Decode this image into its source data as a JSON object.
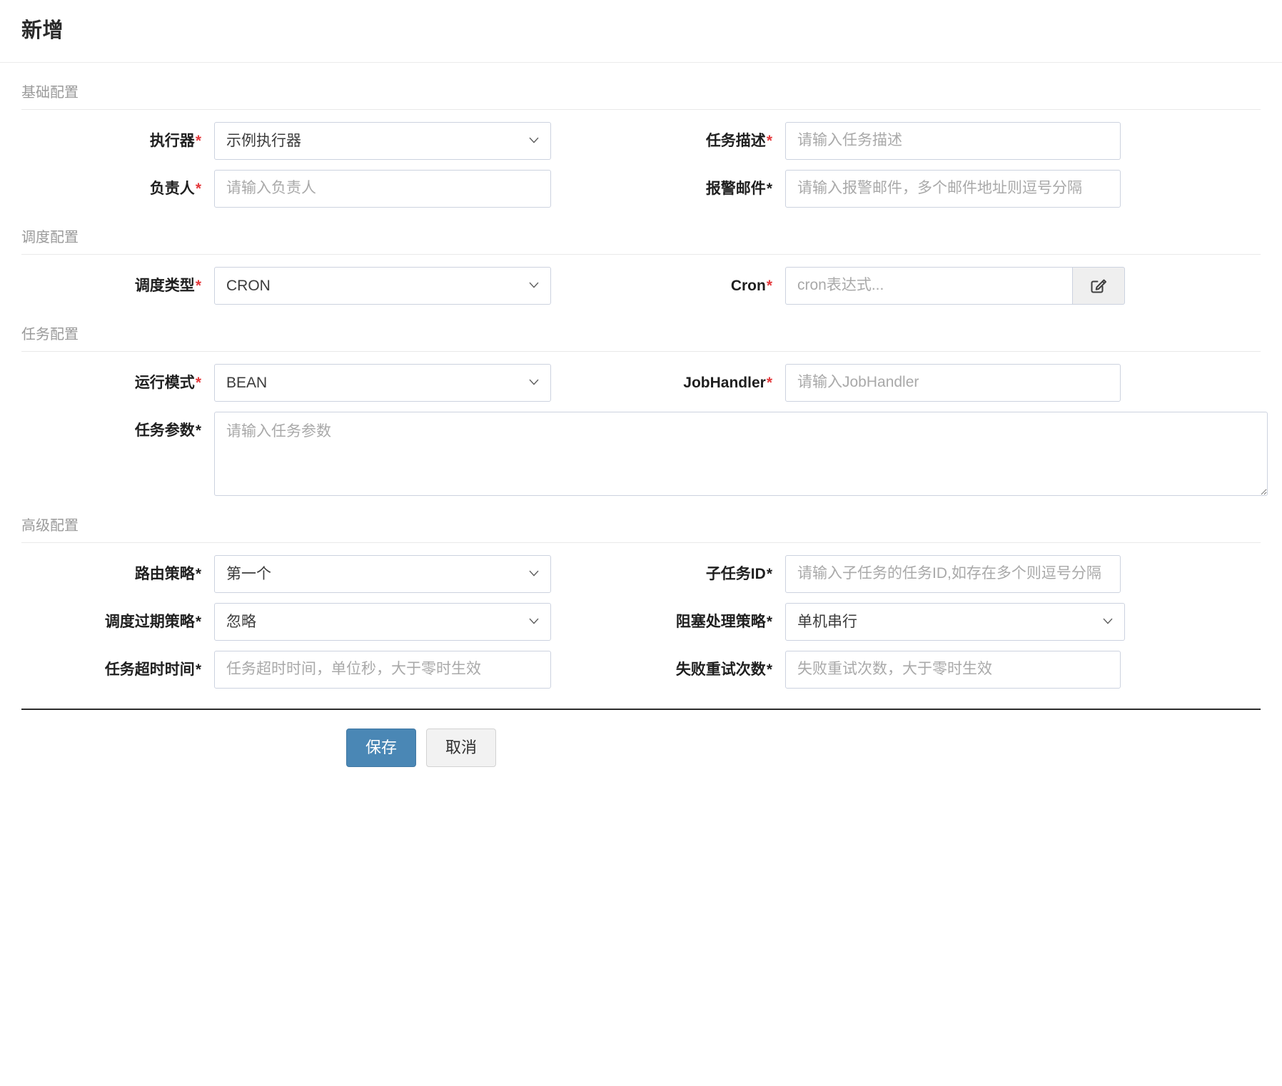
{
  "page": {
    "title": "新增"
  },
  "sections": {
    "basic": {
      "title": "基础配置",
      "executor": {
        "label": "执行器",
        "required_mark": "*",
        "value": "示例执行器"
      },
      "job_desc": {
        "label": "任务描述",
        "required_mark": "*",
        "placeholder": "请输入任务描述",
        "value": ""
      },
      "owner": {
        "label": "负责人",
        "required_mark": "*",
        "placeholder": "请输入负责人",
        "value": ""
      },
      "alarm_email": {
        "label": "报警邮件",
        "required_mark": "*",
        "placeholder": "请输入报警邮件，多个邮件地址则逗号分隔",
        "value": ""
      }
    },
    "schedule": {
      "title": "调度配置",
      "schedule_type": {
        "label": "调度类型",
        "required_mark": "*",
        "value": "CRON"
      },
      "cron": {
        "label": "Cron",
        "required_mark": "*",
        "placeholder": "cron表达式...",
        "value": "",
        "edit_button_icon": "edit-square-icon"
      }
    },
    "job": {
      "title": "任务配置",
      "glue_type": {
        "label": "运行模式",
        "required_mark": "*",
        "value": "BEAN"
      },
      "job_handler": {
        "label": "JobHandler",
        "required_mark": "*",
        "placeholder": "请输入JobHandler",
        "value": ""
      },
      "executor_param": {
        "label": "任务参数",
        "required_mark": "*",
        "placeholder": "请输入任务参数",
        "value": ""
      }
    },
    "advanced": {
      "title": "高级配置",
      "route_strategy": {
        "label": "路由策略",
        "required_mark": "*",
        "value": "第一个"
      },
      "child_job_id": {
        "label": "子任务ID",
        "required_mark": "*",
        "placeholder": "请输入子任务的任务ID,如存在多个则逗号分隔",
        "value": ""
      },
      "misfire_strategy": {
        "label": "调度过期策略",
        "required_mark": "*",
        "value": "忽略"
      },
      "block_strategy": {
        "label": "阻塞处理策略",
        "required_mark": "*",
        "value": "单机串行"
      },
      "job_timeout": {
        "label": "任务超时时间",
        "required_mark": "*",
        "placeholder": "任务超时时间，单位秒，大于零时生效",
        "value": ""
      },
      "fail_retry_count": {
        "label": "失败重试次数",
        "required_mark": "*",
        "placeholder": "失败重试次数，大于零时生效",
        "value": ""
      }
    }
  },
  "footer": {
    "save_label": "保存",
    "cancel_label": "取消"
  },
  "colors": {
    "primary": "#4a87b5",
    "required_red": "#e4393c",
    "field_border": "#ccd2df",
    "section_title": "#9a9a9a"
  }
}
